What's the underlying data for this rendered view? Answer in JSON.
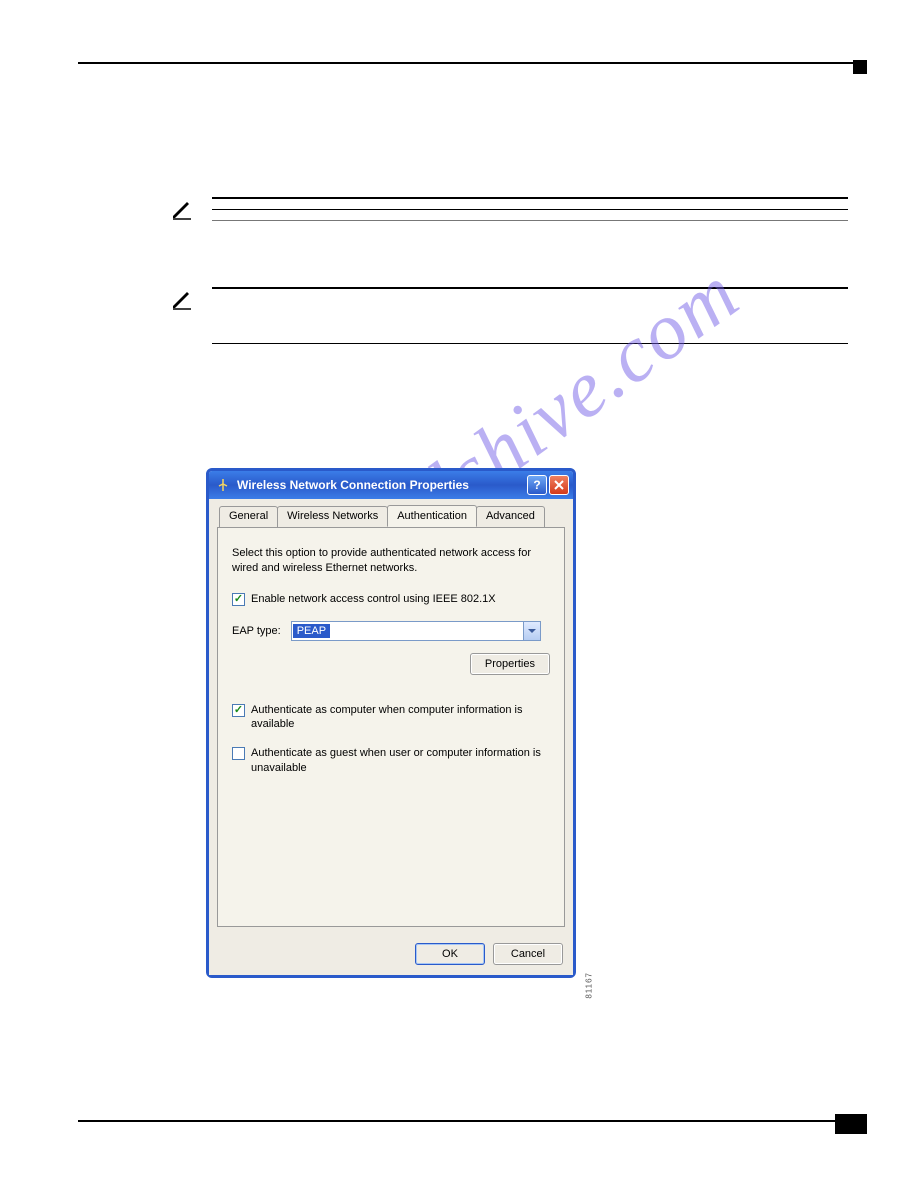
{
  "watermark": "manualshive.com",
  "dialog": {
    "title": "Wireless Network Connection Properties",
    "tabs": {
      "general": "General",
      "wireless": "Wireless Networks",
      "auth": "Authentication",
      "advanced": "Advanced"
    },
    "description": "Select this option to provide authenticated network access for wired and wireless Ethernet networks.",
    "enable_8021x_label": "Enable network access control using IEEE 802.1X",
    "enable_8021x_checked": true,
    "eap_type_label": "EAP type:",
    "eap_type_value": "PEAP",
    "properties_button": "Properties",
    "auth_computer_label": "Authenticate as computer when computer information is available",
    "auth_computer_checked": true,
    "auth_guest_label": "Authenticate as guest when user or computer information is unavailable",
    "auth_guest_checked": false,
    "ok_button": "OK",
    "cancel_button": "Cancel"
  },
  "figure_id": "81167"
}
